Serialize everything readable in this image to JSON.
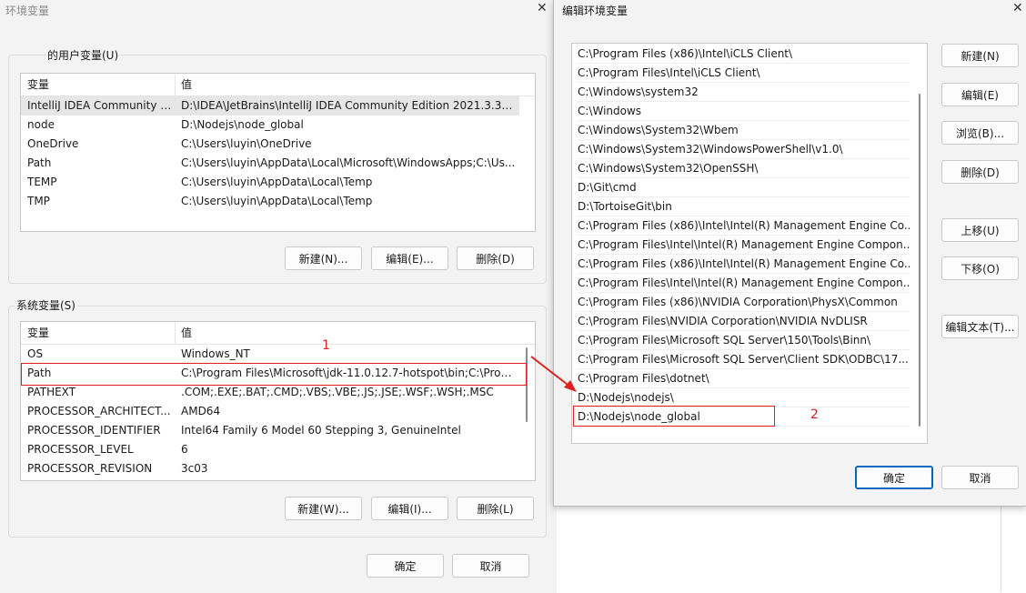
{
  "env_window": {
    "title": "环境变量",
    "user_group_label": "的用户变量(U)",
    "system_group_label": "系统变量(S)",
    "col_var": "变量",
    "col_val": "值",
    "user_vars": [
      {
        "name": "IntelliJ IDEA Community E...",
        "value": "D:\\IDEA\\JetBrains\\IntelliJ IDEA Community Edition 2021.3.3\\bin;"
      },
      {
        "name": "node",
        "value": "D:\\Nodejs\\node_global"
      },
      {
        "name": "OneDrive",
        "value": "C:\\Users\\luyin\\OneDrive"
      },
      {
        "name": "Path",
        "value": "C:\\Users\\luyin\\AppData\\Local\\Microsoft\\WindowsApps;C:\\Us..."
      },
      {
        "name": "TEMP",
        "value": "C:\\Users\\luyin\\AppData\\Local\\Temp"
      },
      {
        "name": "TMP",
        "value": "C:\\Users\\luyin\\AppData\\Local\\Temp"
      }
    ],
    "system_vars": [
      {
        "name": "OS",
        "value": "Windows_NT"
      },
      {
        "name": "Path",
        "value": "C:\\Program Files\\Microsoft\\jdk-11.0.12.7-hotspot\\bin;C:\\Prog..."
      },
      {
        "name": "PATHEXT",
        "value": ".COM;.EXE;.BAT;.CMD;.VBS;.VBE;.JS;.JSE;.WSF;.WSH;.MSC"
      },
      {
        "name": "PROCESSOR_ARCHITECT...",
        "value": "AMD64"
      },
      {
        "name": "PROCESSOR_IDENTIFIER",
        "value": "Intel64 Family 6 Model 60 Stepping 3, GenuineIntel"
      },
      {
        "name": "PROCESSOR_LEVEL",
        "value": "6"
      },
      {
        "name": "PROCESSOR_REVISION",
        "value": "3c03"
      }
    ],
    "user_buttons": {
      "new": "新建(N)...",
      "edit": "编辑(E)...",
      "delete": "删除(D)"
    },
    "system_buttons": {
      "new": "新建(W)...",
      "edit": "编辑(I)...",
      "delete": "删除(L)"
    },
    "ok": "确定",
    "cancel": "取消"
  },
  "annotations": {
    "label1": "1",
    "label2": "2",
    "color": "#e02020"
  },
  "edit_dialog": {
    "title": "编辑环境变量",
    "paths": [
      "C:\\Program Files (x86)\\Intel\\iCLS Client\\",
      "C:\\Program Files\\Intel\\iCLS Client\\",
      "C:\\Windows\\system32",
      "C:\\Windows",
      "C:\\Windows\\System32\\Wbem",
      "C:\\Windows\\System32\\WindowsPowerShell\\v1.0\\",
      "C:\\Windows\\System32\\OpenSSH\\",
      "D:\\Git\\cmd",
      "D:\\TortoiseGit\\bin",
      "C:\\Program Files (x86)\\Intel\\Intel(R) Management Engine Co...",
      "C:\\Program Files\\Intel\\Intel(R) Management Engine Compon...",
      "C:\\Program Files (x86)\\Intel\\Intel(R) Management Engine Co...",
      "C:\\Program Files\\Intel\\Intel(R) Management Engine Compon...",
      "C:\\Program Files (x86)\\NVIDIA Corporation\\PhysX\\Common",
      "C:\\Program Files\\NVIDIA Corporation\\NVIDIA NvDLISR",
      "C:\\Program Files\\Microsoft SQL Server\\150\\Tools\\Binn\\",
      "C:\\Program Files\\Microsoft SQL Server\\Client SDK\\ODBC\\17...",
      "C:\\Program Files\\dotnet\\",
      "D:\\Nodejs\\nodejs\\",
      "D:\\Nodejs\\node_global"
    ],
    "buttons": {
      "new": "新建(N)",
      "edit": "编辑(E)",
      "browse": "浏览(B)...",
      "delete": "删除(D)",
      "move_up": "上移(U)",
      "move_down": "下移(O)",
      "edit_text": "编辑文本(T)..."
    },
    "ok": "确定",
    "cancel": "取消"
  }
}
